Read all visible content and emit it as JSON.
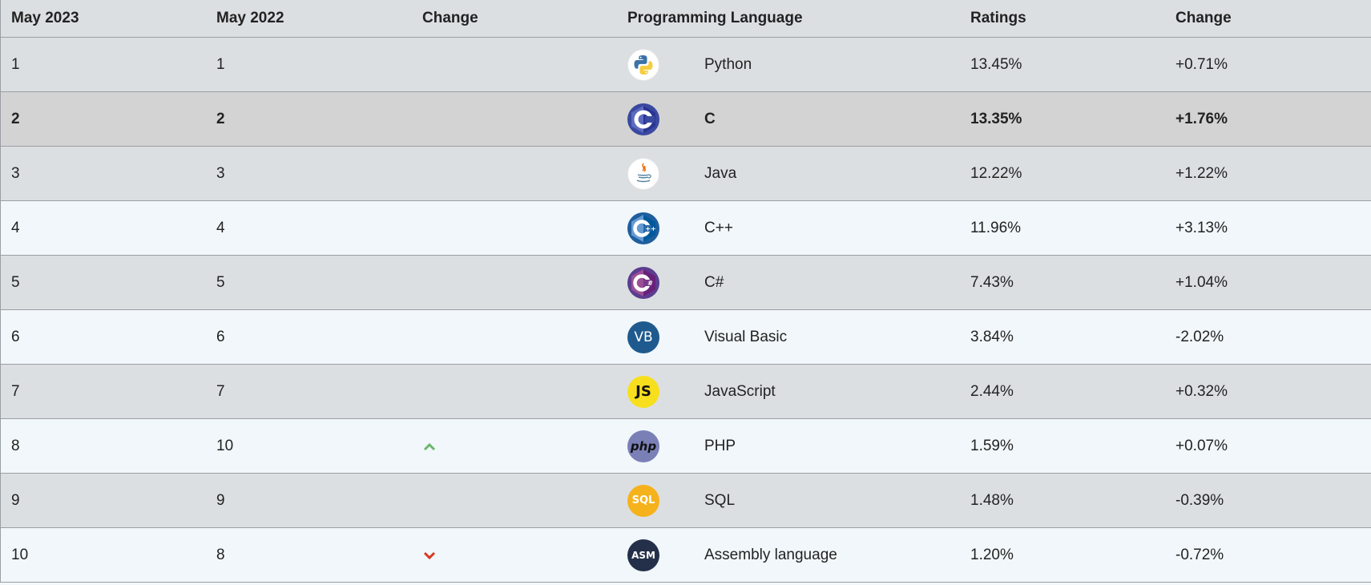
{
  "header": {
    "col1": "May 2023",
    "col2": "May 2022",
    "col3": "Change",
    "col4": "Programming Language",
    "col5": "Ratings",
    "col6": "Change"
  },
  "colors": {
    "up_arrow": "#6ab76a",
    "down_arrow": "#d9381e",
    "highlight_row": "#d3d3d3"
  },
  "rows": [
    {
      "rank_now": "1",
      "rank_prev": "1",
      "trend": "",
      "logo": "python-logo",
      "language": "Python",
      "rating": "13.45%",
      "change": "+0.71%"
    },
    {
      "rank_now": "2",
      "rank_prev": "2",
      "trend": "",
      "logo": "c-logo",
      "language": "C",
      "rating": "13.35%",
      "change": "+1.76%"
    },
    {
      "rank_now": "3",
      "rank_prev": "3",
      "trend": "",
      "logo": "java-logo",
      "language": "Java",
      "rating": "12.22%",
      "change": "+1.22%"
    },
    {
      "rank_now": "4",
      "rank_prev": "4",
      "trend": "",
      "logo": "cpp-logo",
      "language": "C++",
      "rating": "11.96%",
      "change": "+3.13%"
    },
    {
      "rank_now": "5",
      "rank_prev": "5",
      "trend": "",
      "logo": "csharp-logo",
      "language": "C#",
      "rating": "7.43%",
      "change": "+1.04%"
    },
    {
      "rank_now": "6",
      "rank_prev": "6",
      "trend": "",
      "logo": "visual-basic-logo",
      "language": "Visual Basic",
      "rating": "3.84%",
      "change": "-2.02%"
    },
    {
      "rank_now": "7",
      "rank_prev": "7",
      "trend": "",
      "logo": "javascript-logo",
      "language": "JavaScript",
      "rating": "2.44%",
      "change": "+0.32%"
    },
    {
      "rank_now": "8",
      "rank_prev": "10",
      "trend": "up",
      "logo": "php-logo",
      "language": "PHP",
      "rating": "1.59%",
      "change": "+0.07%"
    },
    {
      "rank_now": "9",
      "rank_prev": "9",
      "trend": "",
      "logo": "sql-logo",
      "language": "SQL",
      "rating": "1.48%",
      "change": "-0.39%"
    },
    {
      "rank_now": "10",
      "rank_prev": "8",
      "trend": "down",
      "logo": "assembly-logo",
      "language": "Assembly language",
      "rating": "1.20%",
      "change": "-0.72%"
    }
  ],
  "logos": {
    "vb_text": "VB",
    "js_text": "JS",
    "php_text": "php",
    "sql_text": "SQL",
    "asm_text": "ASM"
  }
}
